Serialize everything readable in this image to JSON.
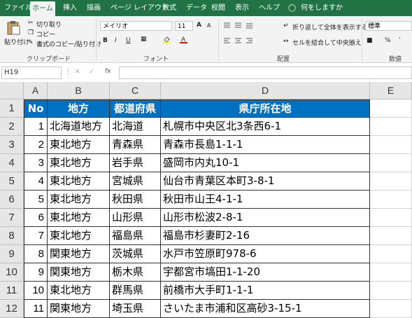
{
  "ribbon": {
    "tabs": [
      "ファイル",
      "ホーム",
      "挿入",
      "描画",
      "ページ レイアウト",
      "数式",
      "データ",
      "校閲",
      "表示",
      "ヘルプ",
      "何をしますか"
    ],
    "active_tab": "ホーム",
    "clipboard": {
      "paste": "貼り付け",
      "cut": "切り取り",
      "copy": "コピー",
      "format_painter": "書式のコピー/貼り付け",
      "group": "クリップボード"
    },
    "font": {
      "name": "メイリオ",
      "size": "11",
      "group": "フォント",
      "bold": "B",
      "italic": "I",
      "underline": "U",
      "grow": "A",
      "shrink": "A"
    },
    "alignment": {
      "wrap": "折り返して全体を表示する",
      "merge": "セルを結合して中央揃え",
      "group": "配置"
    },
    "number": {
      "format": "標準",
      "group": "数値",
      "percent": "%"
    }
  },
  "formula_bar": {
    "name_box": "H19",
    "fx": "fx",
    "formula": ""
  },
  "columns": [
    "A",
    "B",
    "C",
    "D",
    "E"
  ],
  "rows": [
    "1",
    "2",
    "3",
    "4",
    "5",
    "6",
    "7",
    "8",
    "9",
    "10",
    "11",
    "12"
  ],
  "table": {
    "headers": [
      "No",
      "地方",
      "都道府県",
      "県庁所在地"
    ],
    "data": [
      [
        "1",
        "北海道地方",
        "北海道",
        "札幌市中央区北3条西6-1"
      ],
      [
        "2",
        "東北地方",
        "青森県",
        "青森市長島1-1-1"
      ],
      [
        "3",
        "東北地方",
        "岩手県",
        "盛岡市内丸10-1"
      ],
      [
        "4",
        "東北地方",
        "宮城県",
        "仙台市青葉区本町3-8-1"
      ],
      [
        "5",
        "東北地方",
        "秋田県",
        "秋田市山王4-1-1"
      ],
      [
        "6",
        "東北地方",
        "山形県",
        "山形市松波2-8-1"
      ],
      [
        "7",
        "東北地方",
        "福島県",
        "福島市杉妻町2-16"
      ],
      [
        "8",
        "関東地方",
        "茨城県",
        "水戸市笠原町978-6"
      ],
      [
        "9",
        "関東地方",
        "栃木県",
        "宇都宮市塙田1-1-20"
      ],
      [
        "10",
        "東北地方",
        "群馬県",
        "前橋市大手町1-1-1"
      ],
      [
        "11",
        "関東地方",
        "埼玉県",
        "さいたま市浦和区高砂3-15-1"
      ]
    ]
  },
  "colors": {
    "excel_green": "#217346",
    "header_fill": "#0070c0"
  }
}
